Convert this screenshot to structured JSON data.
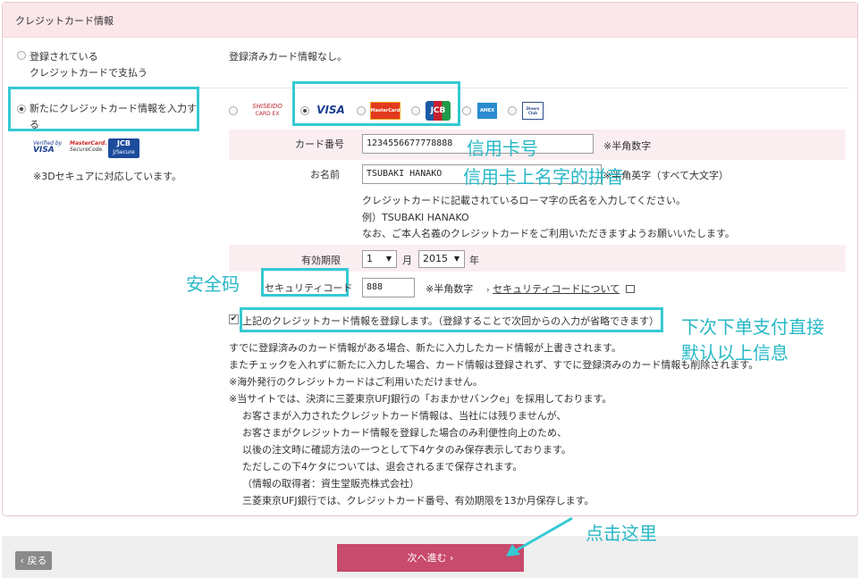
{
  "panel": {
    "title": "クレジットカード情報"
  },
  "options": {
    "registered_label_line1": "登録されている",
    "registered_label_line2": "クレジットカードで支払う",
    "registered_value": "登録済みカード情報なし。",
    "new_label_line1": "新たにクレジットカード情報を入力す",
    "new_label_line2": "る",
    "secure_note": "※3Dセキュアに対応しています。"
  },
  "secure_logos": {
    "verified_line1": "Verified by",
    "verified_line2": "VISA",
    "mastercard_line1": "MasterCard.",
    "mastercard_line2": "SecureCode.",
    "jcb_line1": "JCB",
    "jcb_line2": "J/Secure"
  },
  "card_brands": {
    "shiseido_line1": "SHISEIDO",
    "shiseido_line2": "CARD EX",
    "visa": "VISA",
    "mastercard": "MasterCard",
    "jcb": "JCB",
    "amex": "AMEX",
    "diners": "Diners Club"
  },
  "form": {
    "card_number_label": "カード番号",
    "card_number_value": "1234556677778888",
    "card_number_note": "※半角数字",
    "name_label": "お名前",
    "name_value": "TSUBAKI HANAKO",
    "name_note": "※半角英字（すべて大文字）",
    "name_help_1": "クレジットカードに記載されているローマ字の氏名を入力してください。",
    "name_help_2": "例）TSUBAKI HANAKO",
    "name_help_3": "なお、ご本人名義のクレジットカードをご利用いただきますようお願いいたします。",
    "expiry_label": "有効期限",
    "expiry_month": "1",
    "expiry_month_unit": "月",
    "expiry_year": "2015",
    "expiry_year_unit": "年",
    "security_label": "セキュリティコード",
    "security_value": "888",
    "security_note": "※半角数字",
    "security_link": "セキュリティコードについて",
    "register_checkbox_label": "上記のクレジットカード情報を登録します。（登録することで次回からの入力が省略できます）"
  },
  "notes": [
    "すでに登録済みのカード情報がある場合、新たに入力したカード情報が上書きされます。",
    "またチェックを入れずに新たに入力した場合、カード情報は登録されず、すでに登録済みのカード情報も削除されます。",
    "※海外発行のクレジットカードはご利用いただけません。",
    "※当サイトでは、決済に三菱東京UFJ銀行の「おまかせバンクe」を採用しております。",
    "お客さまが入力されたクレジットカード情報は、当社には残りませんが、",
    "お客さまがクレジットカード情報を登録した場合のみ利便性向上のため、",
    "以後の注文時に確認方法の一つとして下4ケタのみ保存表示しております。",
    "ただしこの下4ケタについては、退会されるまで保存されます。",
    "（情報の取得者：資生堂販売株式会社）",
    "三菱東京UFJ銀行では、クレジットカード番号、有効期限を13か月保存します。"
  ],
  "footer": {
    "back_label": "‹ 戻る",
    "next_label": "次へ進む ›"
  },
  "annotations": {
    "card_number": "信用卡号",
    "card_name": "信用卡上名字的拼音",
    "security_code": "安全码",
    "remember_line1": "下次下单支付直接",
    "remember_line2": "默认以上信息",
    "click_here": "点击这里"
  },
  "colors": {
    "accent_cyan": "#35c9d3",
    "header_pink": "#fbe6ea",
    "row_pink": "#fbeef1",
    "next_button": "#c84a6c"
  }
}
